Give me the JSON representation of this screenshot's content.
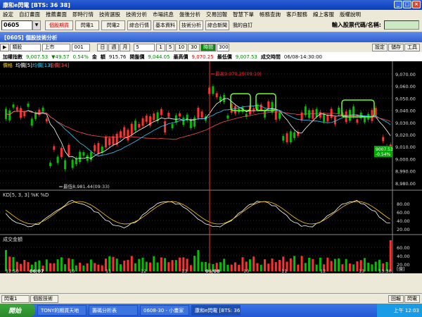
{
  "window_title": "康和e閃電 [BTS: 36 38]",
  "menu": [
    "設定",
    "自訂畫面",
    "推薦畫面",
    "即時行情",
    "技術選股",
    "技術分析",
    "市場訊息",
    "盤後分析",
    "交易回報",
    "智慧下單",
    "帳務查詢",
    "客戶服務",
    "線上客服",
    "版權說明"
  ],
  "toolbar": {
    "code": "0605",
    "buttons": [
      "個股期貨",
      "閃電1",
      "閃電2",
      "綜合行情",
      "基本資料",
      "技術分析",
      "綜合新聞"
    ],
    "my_items": "我的自訂",
    "input_label": "輸入股票代碼/名稱:"
  },
  "subwindow_title": "[0605] 個股技術分析",
  "controls": {
    "type": "類股",
    "market": "上市",
    "code": "001",
    "periods": [
      "日",
      "週",
      "月"
    ],
    "count": "5",
    "minutes": [
      "1",
      "5",
      "10",
      "30"
    ],
    "active": "時間",
    "value": "300",
    "right_buttons": [
      "設定",
      "儲存",
      "工具"
    ]
  },
  "quote": {
    "name": "加權指數",
    "price": "9,007.53",
    "change": "▼49.57",
    "pct": "0.54%",
    "amt_label": "金",
    "amt2_label": "額",
    "amount": "915.76",
    "open_label": "開盤價",
    "open": "9,044.05",
    "high_label": "最高價",
    "high": "9,070.25",
    "low_label": "最低價",
    "low": "9,007.53",
    "time_label": "成交時間",
    "time": "06/08-14:30:00"
  },
  "price_panel": {
    "title": "價格",
    "legend": [
      "均價[5]",
      "均價[13]",
      "均價[34]"
    ],
    "high_note": "最高9,070.25(09:10)",
    "low_note": "最低8,981.44(09:33)",
    "last": "9007.53",
    "last_pct": "-0.54%",
    "ticks": [
      "9,070.00",
      "9,060.00",
      "9,050.00",
      "9,040.00",
      "9,030.00",
      "9,020.00",
      "9,010.00",
      "9,000.00",
      "8,990.00",
      "8,980.00"
    ]
  },
  "kd_panel": {
    "title": "KD[5, 3, 3] %K %D",
    "ticks": [
      "80.00",
      "60.00",
      "40.00",
      "20.00"
    ]
  },
  "vol_panel": {
    "title": "成交金額",
    "ticks": [
      "60.00",
      "40.00",
      "20.00"
    ],
    "unit": "[億]"
  },
  "xaxis": [
    "12:50",
    "06/07",
    "10",
    "11",
    "12",
    "13",
    "06/08",
    "10",
    "11",
    "12",
    "13",
    "13:30"
  ],
  "bottom_tabs": [
    "閃電1",
    "個股技術"
  ],
  "bottom_right": [
    "回報",
    "閃電"
  ],
  "taskbar": {
    "start": "開始",
    "tasks": [
      "TONY的期貨天地",
      "籌碼分析表",
      "0608-30 - 小畫家",
      "康和e閃電 [BTS: 36"
    ],
    "clock": "上午 12:03"
  },
  "colors": {
    "up": "#ff3030",
    "down": "#00c000",
    "ma5": "#ffffff",
    "ma13": "#33ccff",
    "ma34": "#ff4d4d",
    "highlight": "#66ff33"
  }
}
